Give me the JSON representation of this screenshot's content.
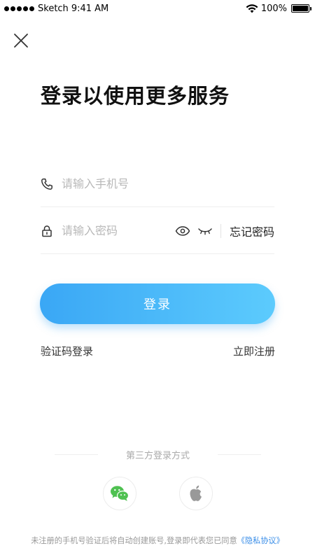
{
  "status_bar": {
    "carrier": "Sketch",
    "time": "9:41 AM",
    "battery": "100%",
    "battery_level": 1.0
  },
  "header": {
    "close_icon": "close-icon",
    "title": "登录以使用更多服务"
  },
  "form": {
    "phone": {
      "placeholder": "请输入手机号",
      "value": "",
      "icon": "phone-icon"
    },
    "password": {
      "placeholder": "请输入密码",
      "value": "",
      "icon": "lock-icon"
    },
    "show_password_icon": "eye-icon",
    "hide_password_icon": "eye-closed-icon",
    "forgot_label": "忘记密码"
  },
  "actions": {
    "login_label": "登录",
    "sms_login_label": "验证码登录",
    "register_label": "立即注册"
  },
  "third_party": {
    "label": "第三方登录方式",
    "providers": [
      {
        "icon": "wechat-icon",
        "color": "#4fc151"
      },
      {
        "icon": "apple-icon",
        "color": "#999999"
      }
    ]
  },
  "footer": {
    "agreement_text": "未注册的手机号验证后将自动创建账号,登录即代表您已同意",
    "privacy_link": "《隐私协议》"
  },
  "colors": {
    "accent_start": "#3aa7f5",
    "accent_end": "#5ccbfd",
    "link": "#3a8ee8"
  }
}
